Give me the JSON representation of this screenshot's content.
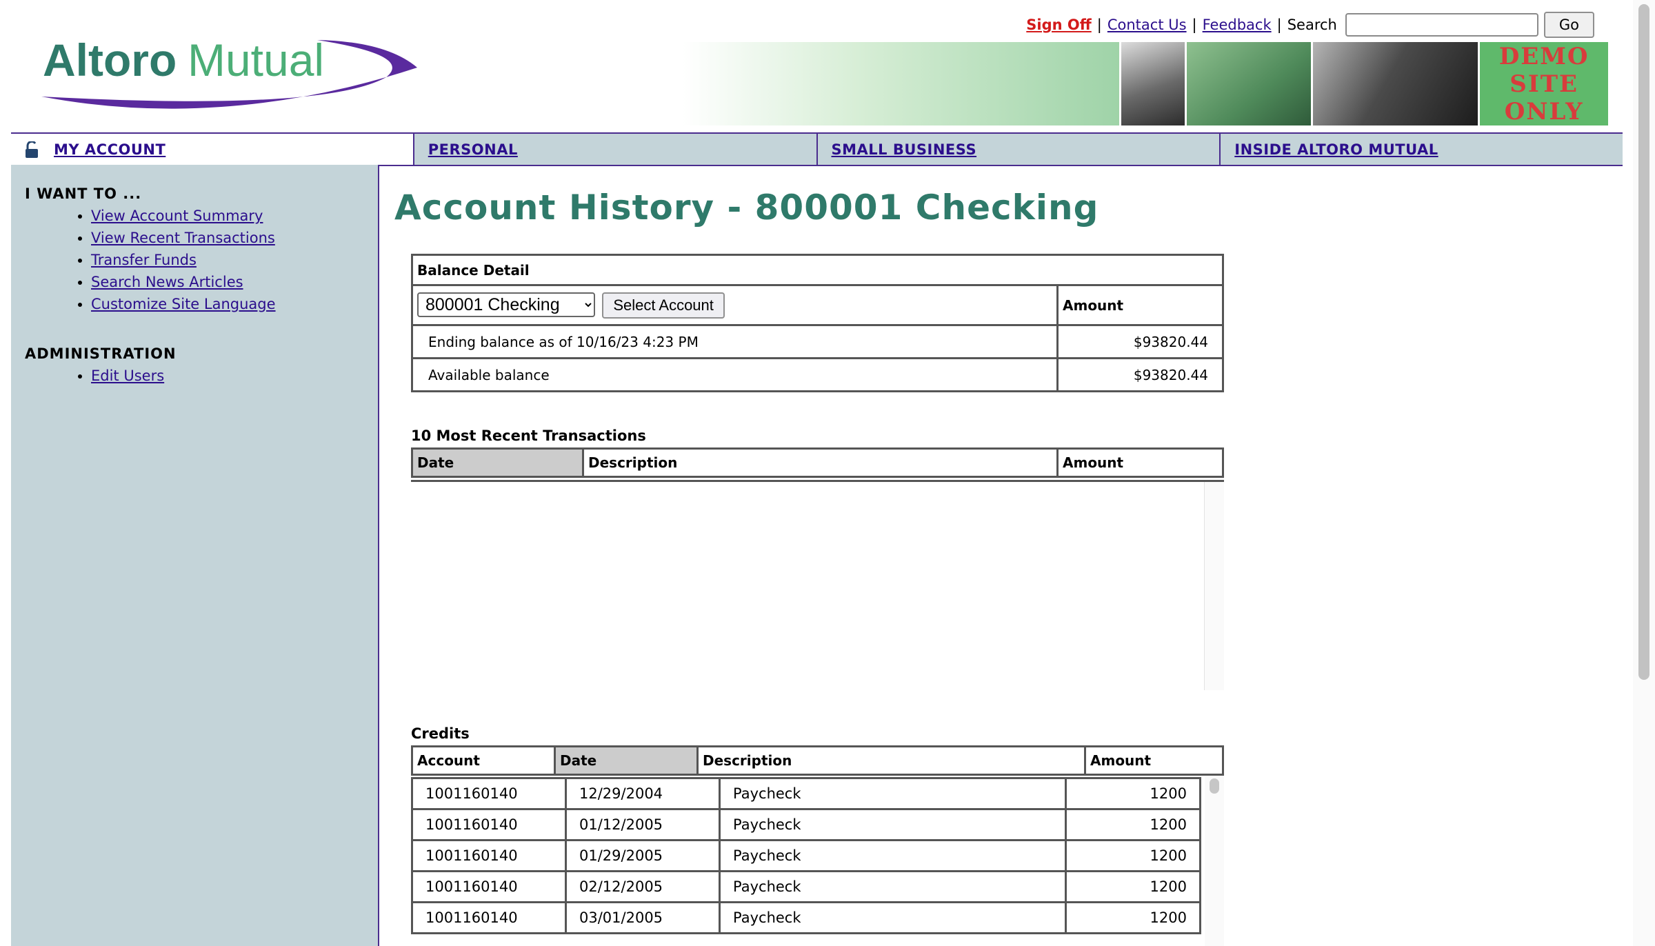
{
  "header": {
    "logo_text": "AltoroMutual",
    "sign_off": "Sign Off",
    "contact_us": "Contact Us",
    "feedback": "Feedback",
    "search_label": "Search",
    "search_value": "",
    "go_label": "Go",
    "separator": "|",
    "demo_stamp": "DEMO SITE ONLY"
  },
  "nav": [
    {
      "label": "MY ACCOUNT"
    },
    {
      "label": "PERSONAL"
    },
    {
      "label": "SMALL BUSINESS"
    },
    {
      "label": "INSIDE ALTORO MUTUAL"
    }
  ],
  "sidebar": {
    "heading": "I WANT TO ...",
    "items": [
      {
        "label": "View Account Summary"
      },
      {
        "label": "View Recent Transactions"
      },
      {
        "label": "Transfer Funds"
      },
      {
        "label": "Search News Articles"
      },
      {
        "label": "Customize Site Language"
      }
    ],
    "admin_heading": "ADMINISTRATION",
    "admin_items": [
      {
        "label": "Edit Users"
      }
    ]
  },
  "main": {
    "title": "Account History - 800001 Checking",
    "balance": {
      "heading": "Balance Detail",
      "selected_account": "800001 Checking",
      "select_button": "Select Account",
      "amount_header": "Amount",
      "ending_label": "Ending balance as of 10/16/23 4:23 PM",
      "ending_value": "$93820.44",
      "available_label": "Available balance",
      "available_value": "$93820.44"
    },
    "recent": {
      "title": "10 Most Recent Transactions",
      "columns": [
        "Date",
        "Description",
        "Amount"
      ]
    },
    "credits": {
      "title": "Credits",
      "columns": [
        "Account",
        "Date",
        "Description",
        "Amount"
      ],
      "rows": [
        {
          "account": "1001160140",
          "date": "12/29/2004",
          "description": "Paycheck",
          "amount": "1200"
        },
        {
          "account": "1001160140",
          "date": "01/12/2005",
          "description": "Paycheck",
          "amount": "1200"
        },
        {
          "account": "1001160140",
          "date": "01/29/2005",
          "description": "Paycheck",
          "amount": "1200"
        },
        {
          "account": "1001160140",
          "date": "02/12/2005",
          "description": "Paycheck",
          "amount": "1200"
        },
        {
          "account": "1001160140",
          "date": "03/01/2005",
          "description": "Paycheck",
          "amount": "1200"
        }
      ]
    }
  },
  "colors": {
    "title_green": "#2f7a6a",
    "nav_purple": "#4a2c8e",
    "sidebar_bg": "#c4d4d9",
    "link": "#2b0e8c",
    "sign_off_red": "#d31a1a"
  }
}
